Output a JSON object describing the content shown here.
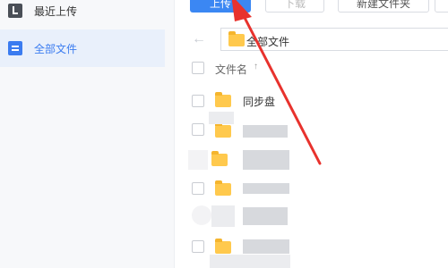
{
  "sidebar": {
    "items": [
      {
        "label": "最近上传",
        "icon": "clock-icon"
      },
      {
        "label": "全部文件",
        "icon": "file-list-icon",
        "active": true
      }
    ]
  },
  "toolbar": {
    "upload_label": "上传",
    "download_label": "下载",
    "new_folder_label": "新建文件夹"
  },
  "path": {
    "current": "全部文件"
  },
  "list": {
    "header_name": "文件名",
    "sort_indicator": "↑",
    "rows": [
      {
        "name": "同步盘"
      },
      {
        "name": ""
      },
      {
        "name": ""
      },
      {
        "name": ""
      },
      {
        "name": ""
      },
      {
        "name": ""
      }
    ]
  },
  "colors": {
    "accent": "#3b87f3",
    "sidebar_bg": "#f7f8fa",
    "sidebar_active_bg": "#e9f0fb",
    "folder": "#ffc94d",
    "annotation": "#e8322d"
  }
}
